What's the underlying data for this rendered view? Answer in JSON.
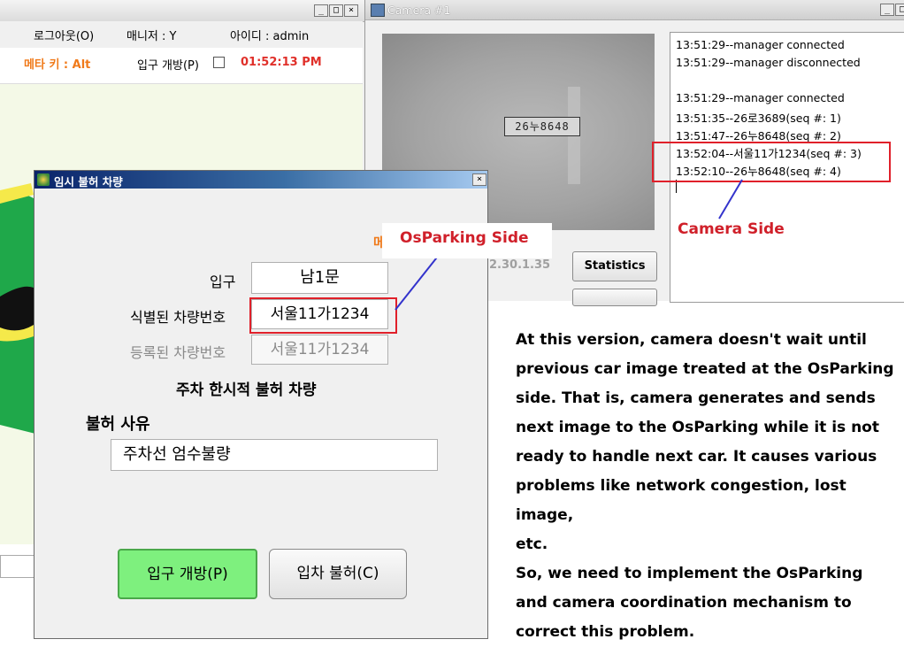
{
  "main_window": {
    "menu": {
      "logout": "로그아웃(O)",
      "manager": "매니저 : Y",
      "user_id": "아이디 : admin"
    },
    "meta_key": "메타 키 : Alt",
    "entry_open_label": "입구 개방(P)",
    "clock": "01:52:13 PM"
  },
  "camera_window": {
    "title": "Camera #1",
    "plate_in_image": "26누8648",
    "ip_address": "2.30.1.35",
    "statistics_button": "Statistics",
    "log": [
      "13:51:29--manager connected",
      "13:51:29--manager disconnected",
      "",
      "13:51:29--manager connected",
      "13:51:35--26로3689(seq #: 1)",
      "13:51:47--26누8648(seq #: 2)",
      "13:52:04--서울11가1234(seq #: 3)",
      "13:52:10--26누8648(seq #: 4)"
    ]
  },
  "dialog": {
    "title": "임시 불허 차량",
    "partial_label": "메",
    "entry_label": "입구",
    "entry_value": "남1문",
    "identified_label": "식별된 차량번호",
    "identified_value": "서울11가1234",
    "registered_label": "등록된 차량번호",
    "registered_value": "서울11가1234",
    "status": "주차 한시적 불허 차량",
    "reason_label": "불허 사유",
    "reason_value": "주차선 엄수불량",
    "open_button": "입구 개방(P)",
    "deny_button": "입차 불허(C)"
  },
  "annotations": {
    "osparking_side": "OsParking Side",
    "camera_side": "Camera Side",
    "notes": [
      "At this version, camera doesn't wait until",
      "previous car image treated at the OsParking",
      "side.  That is, camera generates and sends",
      "next image to the OsParking while it is not",
      "ready to handle next car. It causes various",
      "problems like network congestion, lost image,",
      "etc.",
      "So, we need to implement the OsParking",
      "and camera coordination mechanism to",
      "correct this problem."
    ]
  },
  "colors": {
    "annotation_red": "#d0202a",
    "clock_red": "#e0302a",
    "meta_orange": "#f07a1a",
    "open_button_green": "#7ef07e",
    "arrow_blue": "#3333cc",
    "green_shape": "#1fa84a"
  }
}
